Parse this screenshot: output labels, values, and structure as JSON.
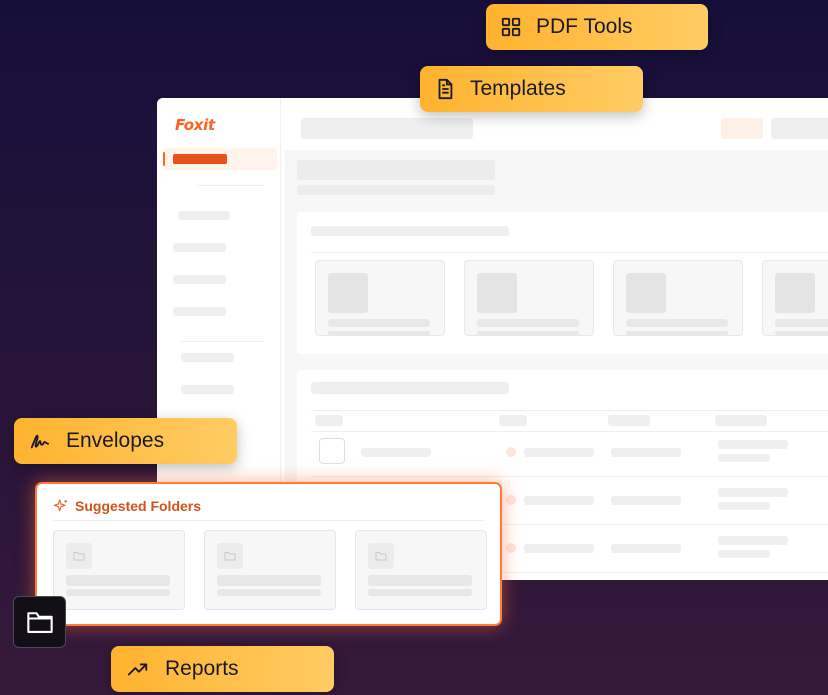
{
  "brand": {
    "logo_text": "Foxit",
    "accent": "#ff5f1f"
  },
  "chips": {
    "pdf_tools": {
      "label": "PDF Tools",
      "icon": "grid-icon"
    },
    "templates": {
      "label": "Templates",
      "icon": "document-icon"
    },
    "envelopes": {
      "label": "Envelopes",
      "icon": "signature-icon"
    },
    "reports": {
      "label": "Reports",
      "icon": "trending-up-icon"
    }
  },
  "suggested": {
    "title": "Suggested Folders",
    "icon": "sparkle-icon"
  },
  "folder_button": {
    "icon": "folder-icon"
  },
  "colors": {
    "chip_gradient_start": "#ffb22e",
    "chip_gradient_end": "#ffcb63",
    "suggested_border": "#ff7b3c",
    "suggested_title": "#d4511c"
  }
}
